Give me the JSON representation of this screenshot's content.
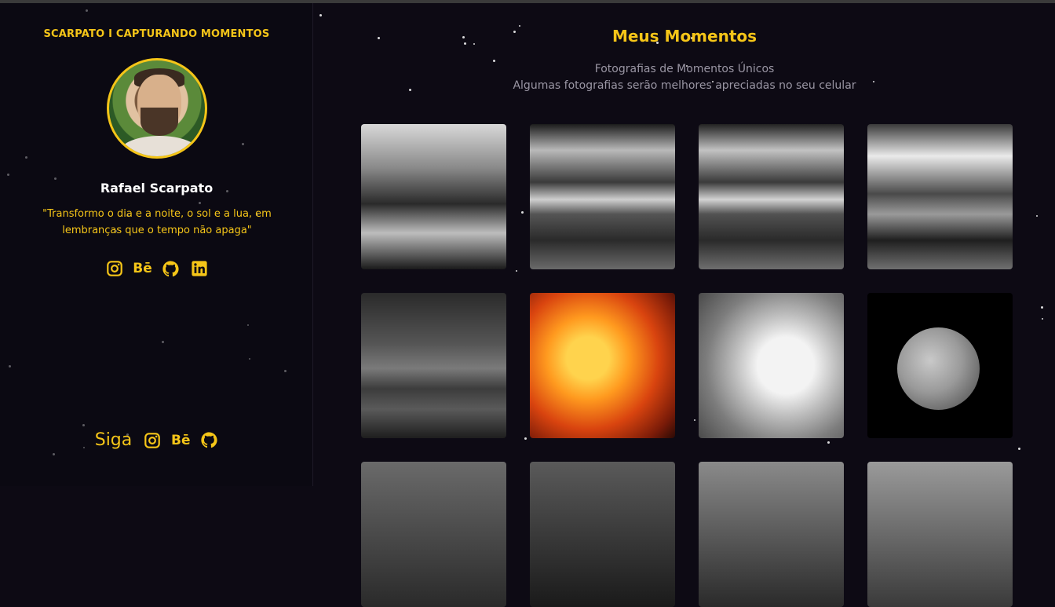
{
  "sidebar": {
    "brand": "SCARPATO I CAPTURANDO MOMENTOS",
    "name": "Rafael Scarpato",
    "quote": "\"Transformo o dia e a noite, o sol e a lua, em lembranças que o tempo não apaga\"",
    "social": [
      "instagram-icon",
      "behance-icon",
      "github-icon",
      "linkedin-icon"
    ],
    "follow_label": "Siga",
    "follow_icons": [
      "instagram-icon",
      "behance-icon",
      "github-icon"
    ]
  },
  "main": {
    "title": "Meus Momentos",
    "subtitle_line1": "Fotografias de Momentos Únicos",
    "subtitle_line2": "Algumas fotografias serão melhores apreciadas no seu celular"
  },
  "colors": {
    "accent": "#f5c518",
    "background": "#0d0a14",
    "muted": "#9a96a4"
  }
}
